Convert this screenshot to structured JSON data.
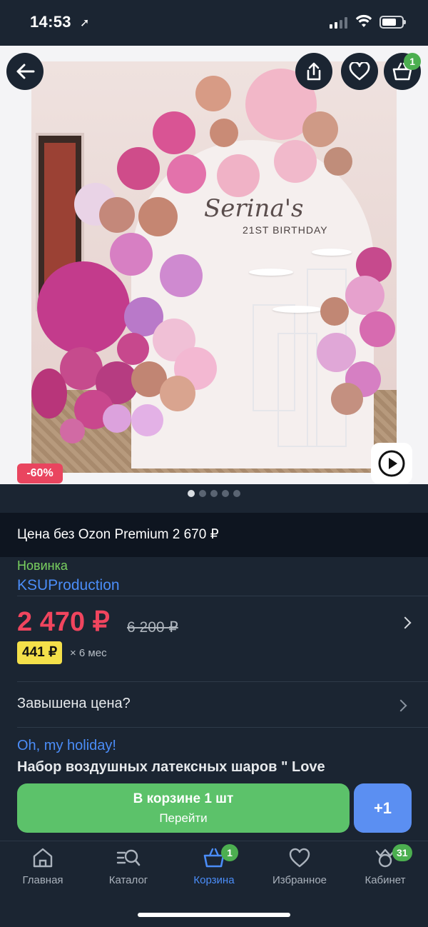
{
  "status": {
    "time": "14:53"
  },
  "gallery": {
    "cart_count": "1",
    "discount": "-60%",
    "photo_text_name": "Serina's",
    "photo_text_event": "21ST BIRTHDAY",
    "dots_total": 5,
    "dots_active": 1
  },
  "premium": {
    "text": "Цена без Ozon Premium 2 670 ₽"
  },
  "product": {
    "badge_new": "Новинка",
    "seller": "KSUProduction",
    "price": "2 470 ₽",
    "old_price": "6 200 ₽",
    "installment_price": "441 ₽",
    "installment_term": "× 6 мес",
    "overpriced_label": "Завышена цена?",
    "brand": "Oh, my holiday!",
    "title": "Набор воздушных латексных шаров \" Love"
  },
  "actions": {
    "in_cart_label": "В корзине 1 шт",
    "go_label": "Перейти",
    "plus_label": "+1"
  },
  "tabbar": {
    "items": [
      {
        "label": "Главная"
      },
      {
        "label": "Каталог"
      },
      {
        "label": "Корзина",
        "badge": "1"
      },
      {
        "label": "Избранное"
      },
      {
        "label": "Кабинет",
        "badge": "31"
      }
    ]
  },
  "colors": {
    "background": "#1b2532",
    "price": "#f0455e",
    "link": "#4b8df8",
    "new": "#7ad160",
    "cart_button": "#5cc26a",
    "plus_button": "#5b8ff2"
  }
}
